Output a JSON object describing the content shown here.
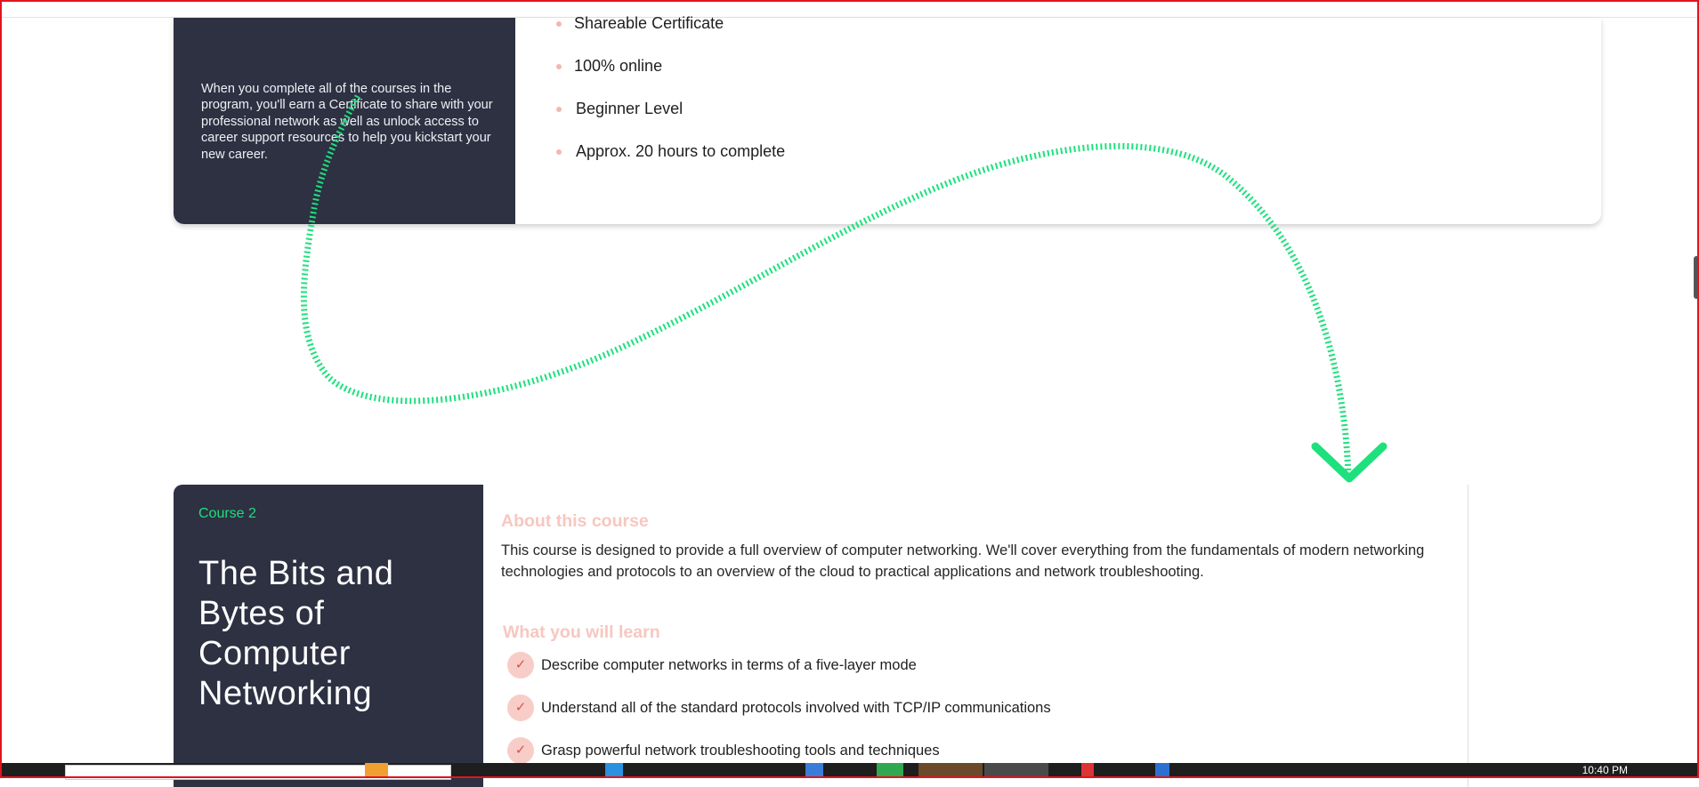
{
  "card1": {
    "certificate_text": "When you complete all of the courses in the program, you'll earn a Certificate to share with your professional network as well as unlock access to career support resources to help you kickstart your new career.",
    "features": [
      "Shareable Certificate",
      "100% online",
      "Beginner Level",
      "Approx. 20 hours to complete"
    ]
  },
  "course2": {
    "number": "Course 2",
    "title": "The Bits and Bytes of Computer Networking",
    "about_heading": "About this course",
    "about_text": "This course is designed to provide a full overview of computer networking. We'll cover everything from the fundamentals of modern networking technologies and protocols to an overview of the cloud to practical applications and network troubleshooting.",
    "learn_heading": "What you will learn",
    "learn_items": [
      "Describe computer networks in terms of a five-layer mode",
      "Understand all of the standard protocols involved with TCP/IP communications",
      "Grasp powerful network troubleshooting tools and techniques"
    ]
  },
  "taskbar": {
    "clock": "10:40 PM"
  },
  "colors": {
    "panel_dark": "#2d3142",
    "accent_green": "#1ee07d",
    "heading_pink": "#f7c7c0",
    "frame_red": "#e0141e"
  },
  "icons": [
    "check-icon",
    "bullet-dot-icon",
    "curved-arrow-annotation"
  ]
}
